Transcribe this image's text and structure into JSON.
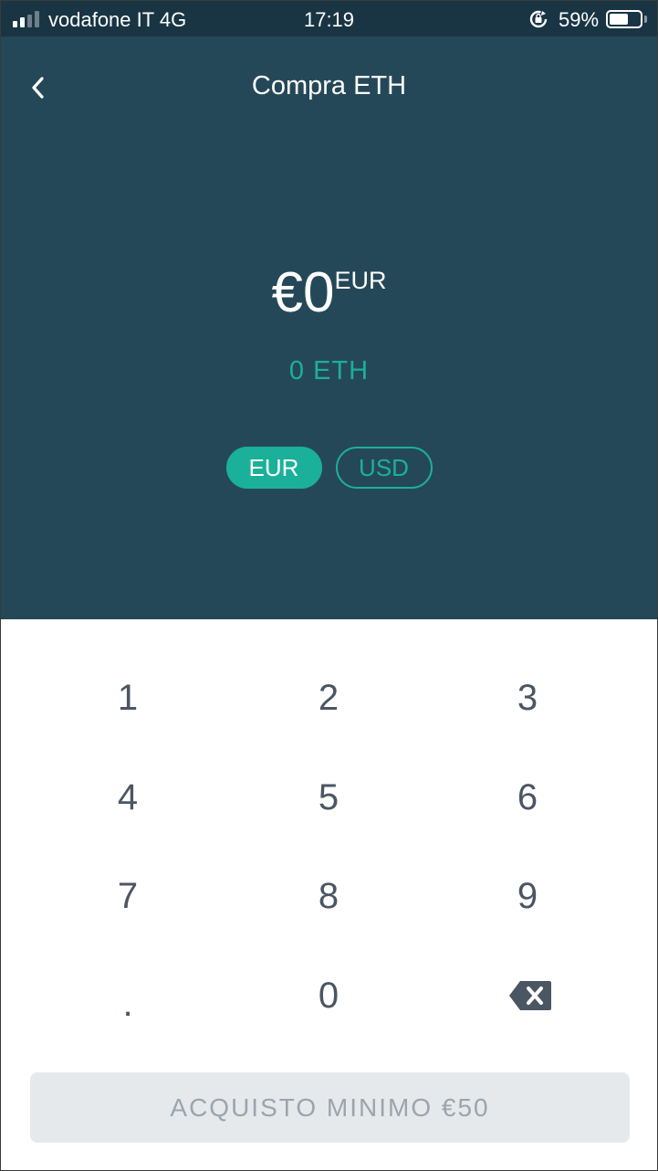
{
  "status_bar": {
    "carrier": "vodafone IT  4G",
    "time": "17:19",
    "battery_percent": "59%",
    "battery_level": 0.59,
    "signal_bars": 2
  },
  "header": {
    "title": "Compra ETH",
    "back_icon": "chevron-left-icon"
  },
  "amount": {
    "value": "€0",
    "unit": "EUR",
    "crypto": "0 ETH"
  },
  "currency_toggle": {
    "options": [
      "EUR",
      "USD"
    ],
    "selected": "EUR"
  },
  "keypad": {
    "keys": [
      "1",
      "2",
      "3",
      "4",
      "5",
      "6",
      "7",
      "8",
      "9",
      ".",
      "0"
    ],
    "backspace_icon": "backspace-icon"
  },
  "submit": {
    "label": "ACQUISTO MINIMO €50"
  },
  "colors": {
    "status_bar_bg": "#193544",
    "panel_bg": "#254858",
    "accent": "#1bb09a",
    "key_text": "#4b5663",
    "button_bg": "#e6e9ec",
    "button_text": "#9aa5ad"
  }
}
